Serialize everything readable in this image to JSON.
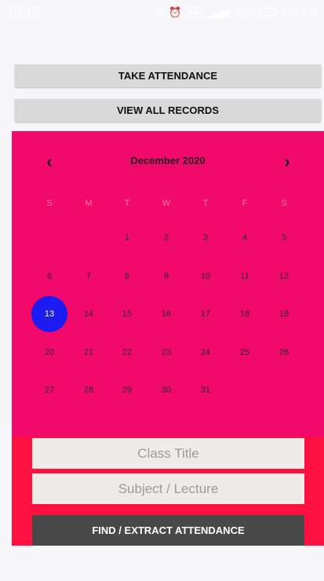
{
  "status_bar": {
    "network": "4G",
    "battery": "50%",
    "time": "3:52 PM"
  },
  "actions": {
    "take_attendance": "TAKE ATTENDANCE",
    "view_all_records": "VIEW ALL RECORDS"
  },
  "calendar": {
    "month_label": "December 2020",
    "prev_icon": "chevron-left-icon",
    "next_icon": "chevron-right-icon",
    "weekdays": [
      "S",
      "M",
      "T",
      "W",
      "T",
      "F",
      "S"
    ],
    "first_weekday_index": 2,
    "days_in_month": 31,
    "selected_day": 13
  },
  "form": {
    "class_title_placeholder": "Class Title",
    "subject_placeholder": "Subject / Lecture",
    "find_button": "FIND / EXTRACT ATTENDANCE"
  },
  "colors": {
    "calendar_bg": "#f1096b",
    "selected_day": "#1c1cf0",
    "form_bg": "#ff1040",
    "find_button_bg": "#484848"
  }
}
